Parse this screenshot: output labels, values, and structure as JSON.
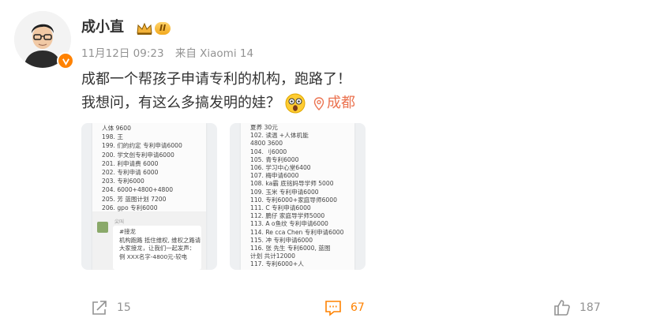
{
  "post": {
    "author": "成小直",
    "level": "II",
    "time": "11月12日 09:23",
    "source": "来自 Xiaomi 14",
    "text_line1": "成都一个帮孩子申请专利的机构，跑路了！",
    "text_line2": "我想问，有这么多搞发明的娃？",
    "location": "成都"
  },
  "images": [
    {
      "lines": [
        "人体   9600",
        "198.  王",
        "199.  们的约定 专利申请6000",
        "200.    学文创专利申请6000",
        "201.    利申请费 6000",
        "202.      专利申请 6000",
        "203.      专利6000",
        "204.   6000+4800+4800",
        "205.    芳 蓝图计划 7200",
        "206.   gpo 专利6000"
      ],
      "chat_header": "尖叫",
      "chat_lines": [
        "#接龙",
        "机构跑路 抵住维权, 维权之路请",
        "大家接龙，让我们一起发声：",
        "例 XXX名字-4800元-较电"
      ]
    },
    {
      "lines": [
        "夏养     30元",
        "102.  读温  +人体机能",
        "4800  3600",
        "104.   刂6000",
        "105.   青专利6000",
        "106.   学习中心堂6400",
        "107.   梅申请6000",
        "108.  ka霸 底铭妈导学师 5000",
        "109.  玉米 专利申请6000",
        "110.   专利6000+家庭导师6000",
        "111.  C  专利申请6000",
        "112.   鹏仔 家庭导学师5000",
        "113. A   o鱼纹 专利申请6000",
        "114. Re  cca Chen 专利申请6000",
        "115.    冲 专利申请6000",
        "116. 张   先生 专利6000, 蓝图",
        "计划   共计12000",
        "117.   专利6000+人"
      ]
    }
  ],
  "actions": {
    "share_count": "15",
    "comment_count": "67",
    "like_count": "187"
  },
  "colors": {
    "accent": "#ff8200",
    "location": "#eb7350",
    "meta": "#939393"
  },
  "icons": [
    "avatar-illustration",
    "verified-icon",
    "crown-icon",
    "shocked-emoji",
    "location-pin-icon",
    "share-icon",
    "comment-icon",
    "like-icon"
  ]
}
